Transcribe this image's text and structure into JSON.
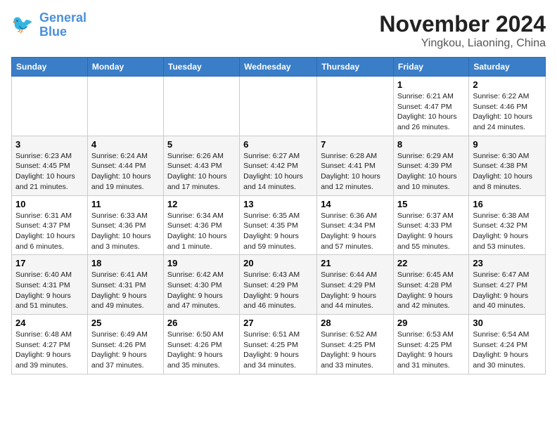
{
  "logo": {
    "line1": "General",
    "line2": "Blue"
  },
  "title": "November 2024",
  "location": "Yingkou, Liaoning, China",
  "headers": [
    "Sunday",
    "Monday",
    "Tuesday",
    "Wednesday",
    "Thursday",
    "Friday",
    "Saturday"
  ],
  "weeks": [
    [
      {
        "day": "",
        "info": ""
      },
      {
        "day": "",
        "info": ""
      },
      {
        "day": "",
        "info": ""
      },
      {
        "day": "",
        "info": ""
      },
      {
        "day": "",
        "info": ""
      },
      {
        "day": "1",
        "info": "Sunrise: 6:21 AM\nSunset: 4:47 PM\nDaylight: 10 hours and 26 minutes."
      },
      {
        "day": "2",
        "info": "Sunrise: 6:22 AM\nSunset: 4:46 PM\nDaylight: 10 hours and 24 minutes."
      }
    ],
    [
      {
        "day": "3",
        "info": "Sunrise: 6:23 AM\nSunset: 4:45 PM\nDaylight: 10 hours and 21 minutes."
      },
      {
        "day": "4",
        "info": "Sunrise: 6:24 AM\nSunset: 4:44 PM\nDaylight: 10 hours and 19 minutes."
      },
      {
        "day": "5",
        "info": "Sunrise: 6:26 AM\nSunset: 4:43 PM\nDaylight: 10 hours and 17 minutes."
      },
      {
        "day": "6",
        "info": "Sunrise: 6:27 AM\nSunset: 4:42 PM\nDaylight: 10 hours and 14 minutes."
      },
      {
        "day": "7",
        "info": "Sunrise: 6:28 AM\nSunset: 4:41 PM\nDaylight: 10 hours and 12 minutes."
      },
      {
        "day": "8",
        "info": "Sunrise: 6:29 AM\nSunset: 4:39 PM\nDaylight: 10 hours and 10 minutes."
      },
      {
        "day": "9",
        "info": "Sunrise: 6:30 AM\nSunset: 4:38 PM\nDaylight: 10 hours and 8 minutes."
      }
    ],
    [
      {
        "day": "10",
        "info": "Sunrise: 6:31 AM\nSunset: 4:37 PM\nDaylight: 10 hours and 6 minutes."
      },
      {
        "day": "11",
        "info": "Sunrise: 6:33 AM\nSunset: 4:36 PM\nDaylight: 10 hours and 3 minutes."
      },
      {
        "day": "12",
        "info": "Sunrise: 6:34 AM\nSunset: 4:36 PM\nDaylight: 10 hours and 1 minute."
      },
      {
        "day": "13",
        "info": "Sunrise: 6:35 AM\nSunset: 4:35 PM\nDaylight: 9 hours and 59 minutes."
      },
      {
        "day": "14",
        "info": "Sunrise: 6:36 AM\nSunset: 4:34 PM\nDaylight: 9 hours and 57 minutes."
      },
      {
        "day": "15",
        "info": "Sunrise: 6:37 AM\nSunset: 4:33 PM\nDaylight: 9 hours and 55 minutes."
      },
      {
        "day": "16",
        "info": "Sunrise: 6:38 AM\nSunset: 4:32 PM\nDaylight: 9 hours and 53 minutes."
      }
    ],
    [
      {
        "day": "17",
        "info": "Sunrise: 6:40 AM\nSunset: 4:31 PM\nDaylight: 9 hours and 51 minutes."
      },
      {
        "day": "18",
        "info": "Sunrise: 6:41 AM\nSunset: 4:31 PM\nDaylight: 9 hours and 49 minutes."
      },
      {
        "day": "19",
        "info": "Sunrise: 6:42 AM\nSunset: 4:30 PM\nDaylight: 9 hours and 47 minutes."
      },
      {
        "day": "20",
        "info": "Sunrise: 6:43 AM\nSunset: 4:29 PM\nDaylight: 9 hours and 46 minutes."
      },
      {
        "day": "21",
        "info": "Sunrise: 6:44 AM\nSunset: 4:29 PM\nDaylight: 9 hours and 44 minutes."
      },
      {
        "day": "22",
        "info": "Sunrise: 6:45 AM\nSunset: 4:28 PM\nDaylight: 9 hours and 42 minutes."
      },
      {
        "day": "23",
        "info": "Sunrise: 6:47 AM\nSunset: 4:27 PM\nDaylight: 9 hours and 40 minutes."
      }
    ],
    [
      {
        "day": "24",
        "info": "Sunrise: 6:48 AM\nSunset: 4:27 PM\nDaylight: 9 hours and 39 minutes."
      },
      {
        "day": "25",
        "info": "Sunrise: 6:49 AM\nSunset: 4:26 PM\nDaylight: 9 hours and 37 minutes."
      },
      {
        "day": "26",
        "info": "Sunrise: 6:50 AM\nSunset: 4:26 PM\nDaylight: 9 hours and 35 minutes."
      },
      {
        "day": "27",
        "info": "Sunrise: 6:51 AM\nSunset: 4:25 PM\nDaylight: 9 hours and 34 minutes."
      },
      {
        "day": "28",
        "info": "Sunrise: 6:52 AM\nSunset: 4:25 PM\nDaylight: 9 hours and 33 minutes."
      },
      {
        "day": "29",
        "info": "Sunrise: 6:53 AM\nSunset: 4:25 PM\nDaylight: 9 hours and 31 minutes."
      },
      {
        "day": "30",
        "info": "Sunrise: 6:54 AM\nSunset: 4:24 PM\nDaylight: 9 hours and 30 minutes."
      }
    ]
  ],
  "colors": {
    "header_bg": "#3a7ec8",
    "header_text": "#ffffff",
    "accent": "#4a90d9"
  }
}
